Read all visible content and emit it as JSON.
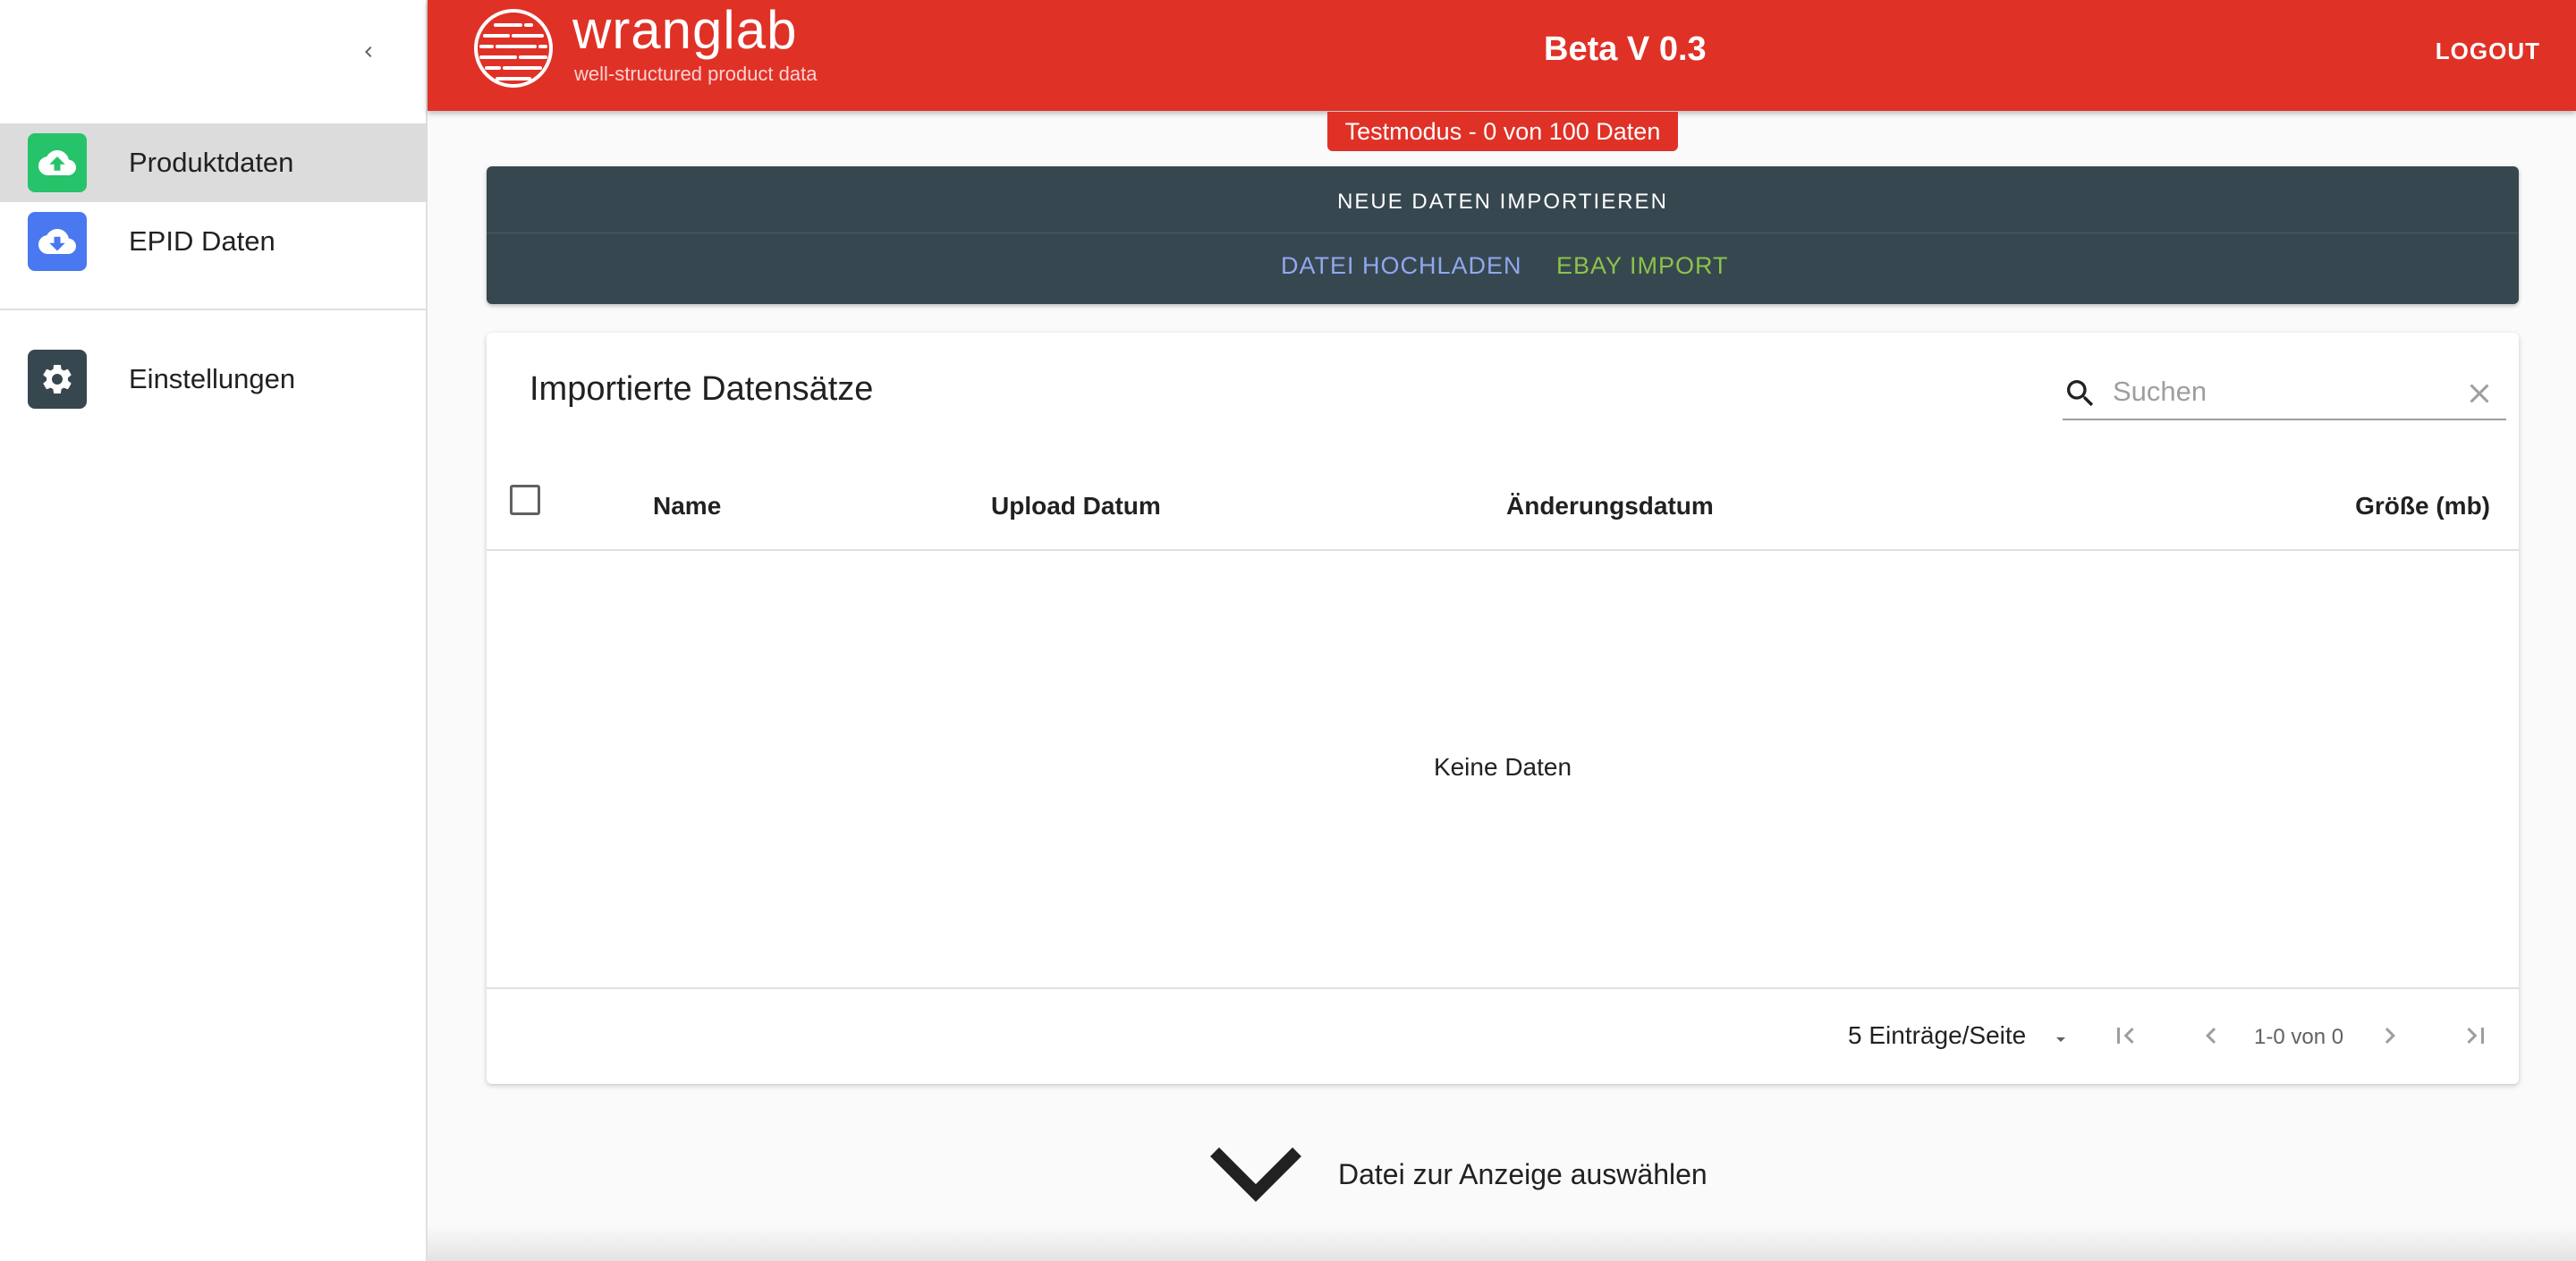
{
  "sidebar": {
    "items": [
      {
        "label": "Produktdaten",
        "icon": "cloud-upload-icon",
        "color": "#27c36a",
        "active": true
      },
      {
        "label": "EPID Daten",
        "icon": "cloud-download-icon",
        "color": "#4a78f0",
        "active": false
      },
      {
        "label": "Einstellungen",
        "icon": "gear-icon",
        "color": "#37474f",
        "active": false
      }
    ]
  },
  "header": {
    "brand": "wranglab",
    "tagline": "well-structured product data",
    "version": "Beta V 0.3",
    "logout": "LOGOUT",
    "color": "#e03127"
  },
  "test_badge": "Testmodus - 0 von 100 Daten",
  "import": {
    "title": "NEUE DATEN IMPORTIEREN",
    "upload_label": "DATEI HOCHLADEN",
    "upload_color": "#8fa8f0",
    "ebay_label": "EBAY IMPORT",
    "ebay_color": "#8bc34a"
  },
  "table": {
    "title": "Importierte Datensätze",
    "search_placeholder": "Suchen",
    "columns": [
      "Name",
      "Upload Datum",
      "Änderungsdatum",
      "Größe (mb)"
    ],
    "empty_text": "Keine Daten",
    "rows_per_page": "5 Einträge/Seite",
    "range": "1-0 von 0"
  },
  "select_hint": "Datei zur Anzeige auswählen"
}
